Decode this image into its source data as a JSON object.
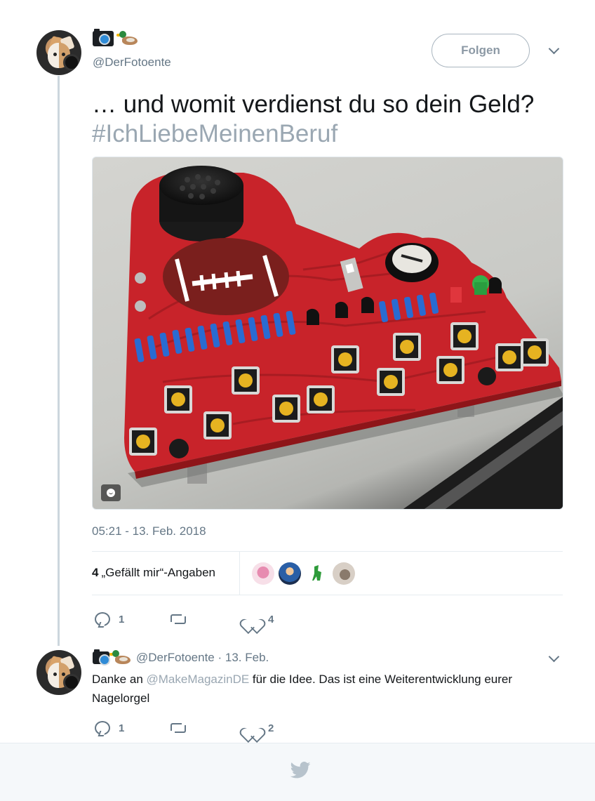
{
  "tweet": {
    "author_handle": "@DerFotoente",
    "follow_label": "Folgen",
    "text": "… und womit verdienst du so dein Geld?",
    "hashtag": "#IchLiebeMeinenBeruf",
    "timestamp": "05:21 - 13. Feb. 2018",
    "likes_count": "4",
    "likes_label": "„Gefällt mir“-Angaben",
    "actions": {
      "replies": "1",
      "retweets": "",
      "likes": "4"
    }
  },
  "reply": {
    "author_handle": "@DerFotoente",
    "separator": " · ",
    "date": "13. Feb.",
    "text_before": "Danke an ",
    "mention": "@MakeMagazinDE",
    "text_after": " für die Idee. Das ist eine Weiterentwicklung eurer Nagelorgel",
    "actions": {
      "replies": "1",
      "retweets": "",
      "likes": "2"
    }
  },
  "colors": {
    "text": "#14171a",
    "secondary": "#657786",
    "hashtag": "#9aa7b2",
    "border": "#e6ecf0",
    "footer_bg": "#f5f8fa",
    "pcb_red": "#c8232a"
  },
  "icons": [
    "camera-emoji",
    "duck-emoji",
    "chevron-down-icon",
    "reply-icon",
    "retweet-icon",
    "like-icon",
    "media-tag-icon",
    "twitter-bird-icon"
  ]
}
